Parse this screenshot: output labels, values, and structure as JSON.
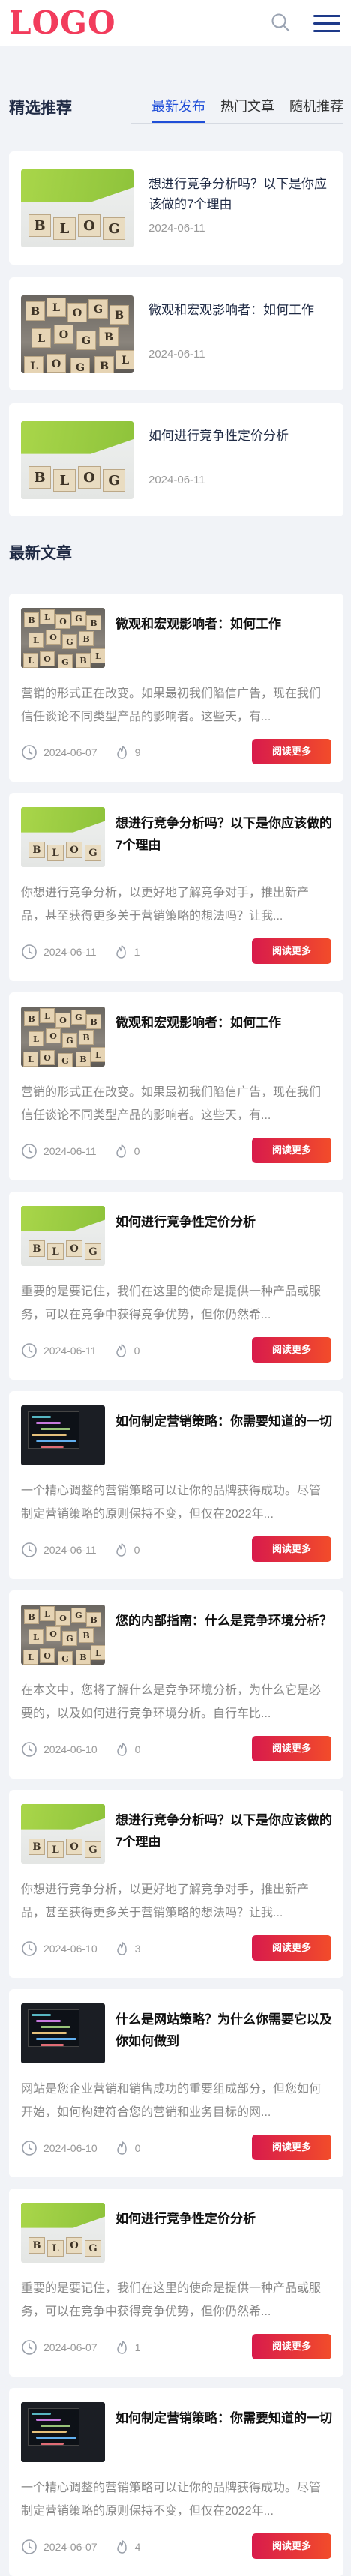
{
  "header": {
    "logo": "LOGO"
  },
  "featured": {
    "title": "精选推荐",
    "tabs": [
      {
        "label": "最新发布",
        "active": true
      },
      {
        "label": "热门文章",
        "active": false
      },
      {
        "label": "随机推荐",
        "active": false
      }
    ],
    "items": [
      {
        "title": "想进行竞争分析吗？以下是你应该做的7个理由",
        "date": "2024-06-11",
        "image": "green-blocks"
      },
      {
        "title": "微观和宏观影响者：如何工作",
        "date": "2024-06-11",
        "image": "wood-blocks"
      },
      {
        "title": "如何进行竞争性定价分析",
        "date": "2024-06-11",
        "image": "green-blocks"
      }
    ]
  },
  "latest": {
    "title": "最新文章",
    "more_label": "阅读更多",
    "articles": [
      {
        "title": "微观和宏观影响者：如何工作",
        "excerpt": "营销的形式正在改变。如果最初我们陷信广告，现在我们信任谈论不同类型产品的影响者。这些天，有...",
        "date": "2024-06-07",
        "likes": "9",
        "image": "wood-blocks"
      },
      {
        "title": "想进行竞争分析吗？以下是你应该做的7个理由",
        "excerpt": "你想进行竞争分析，以更好地了解竞争对手，推出新产品，甚至获得更多关于营销策略的想法吗？让我...",
        "date": "2024-06-11",
        "likes": "1",
        "image": "green-blocks"
      },
      {
        "title": "微观和宏观影响者：如何工作",
        "excerpt": "营销的形式正在改变。如果最初我们陷信广告，现在我们信任谈论不同类型产品的影响者。这些天，有...",
        "date": "2024-06-11",
        "likes": "0",
        "image": "wood-blocks"
      },
      {
        "title": "如何进行竞争性定价分析",
        "excerpt": "重要的是要记住，我们在这里的使命是提供一种产品或服务，可以在竞争中获得竞争优势，但你仍然希...",
        "date": "2024-06-11",
        "likes": "0",
        "image": "green-blocks"
      },
      {
        "title": "如何制定营销策略：你需要知道的一切",
        "excerpt": "一个精心调整的营销策略可以让你的品牌获得成功。尽管制定营销策略的原则保持不变，但仅在2022年...",
        "date": "2024-06-11",
        "likes": "0",
        "image": "laptop"
      },
      {
        "title": "您的内部指南：什么是竞争环境分析？",
        "excerpt": "在本文中，您将了解什么是竞争环境分析，为什么它是必要的，以及如何进行竞争环境分析。自行车比...",
        "date": "2024-06-10",
        "likes": "0",
        "image": "wood-blocks"
      },
      {
        "title": "想进行竞争分析吗？以下是你应该做的7个理由",
        "excerpt": "你想进行竞争分析，以更好地了解竞争对手，推出新产品，甚至获得更多关于营销策略的想法吗？让我...",
        "date": "2024-06-10",
        "likes": "3",
        "image": "green-blocks"
      },
      {
        "title": "什么是网站策略？为什么你需要它以及你如何做到",
        "excerpt": "网站是您企业营销和销售成功的重要组成部分，但您如何开始，如何构建符合您的营销和业务目标的网...",
        "date": "2024-06-10",
        "likes": "0",
        "image": "laptop"
      },
      {
        "title": "如何进行竞争性定价分析",
        "excerpt": "重要的是要记住，我们在这里的使命是提供一种产品或服务，可以在竞争中获得竞争优势，但你仍然希...",
        "date": "2024-06-07",
        "likes": "1",
        "image": "green-blocks"
      },
      {
        "title": "如何制定营销策略：你需要知道的一切",
        "excerpt": "一个精心调整的营销策略可以让你的品牌获得成功。尽管制定营销策略的原则保持不变，但仅在2022年...",
        "date": "2024-06-07",
        "likes": "4",
        "image": "laptop"
      }
    ]
  },
  "colors": {
    "brand": "#f23c5c",
    "accent": "#1f4ed8",
    "button": "#e0303c"
  },
  "icons": [
    "search-icon",
    "menu-icon",
    "clock-icon",
    "like-icon"
  ]
}
